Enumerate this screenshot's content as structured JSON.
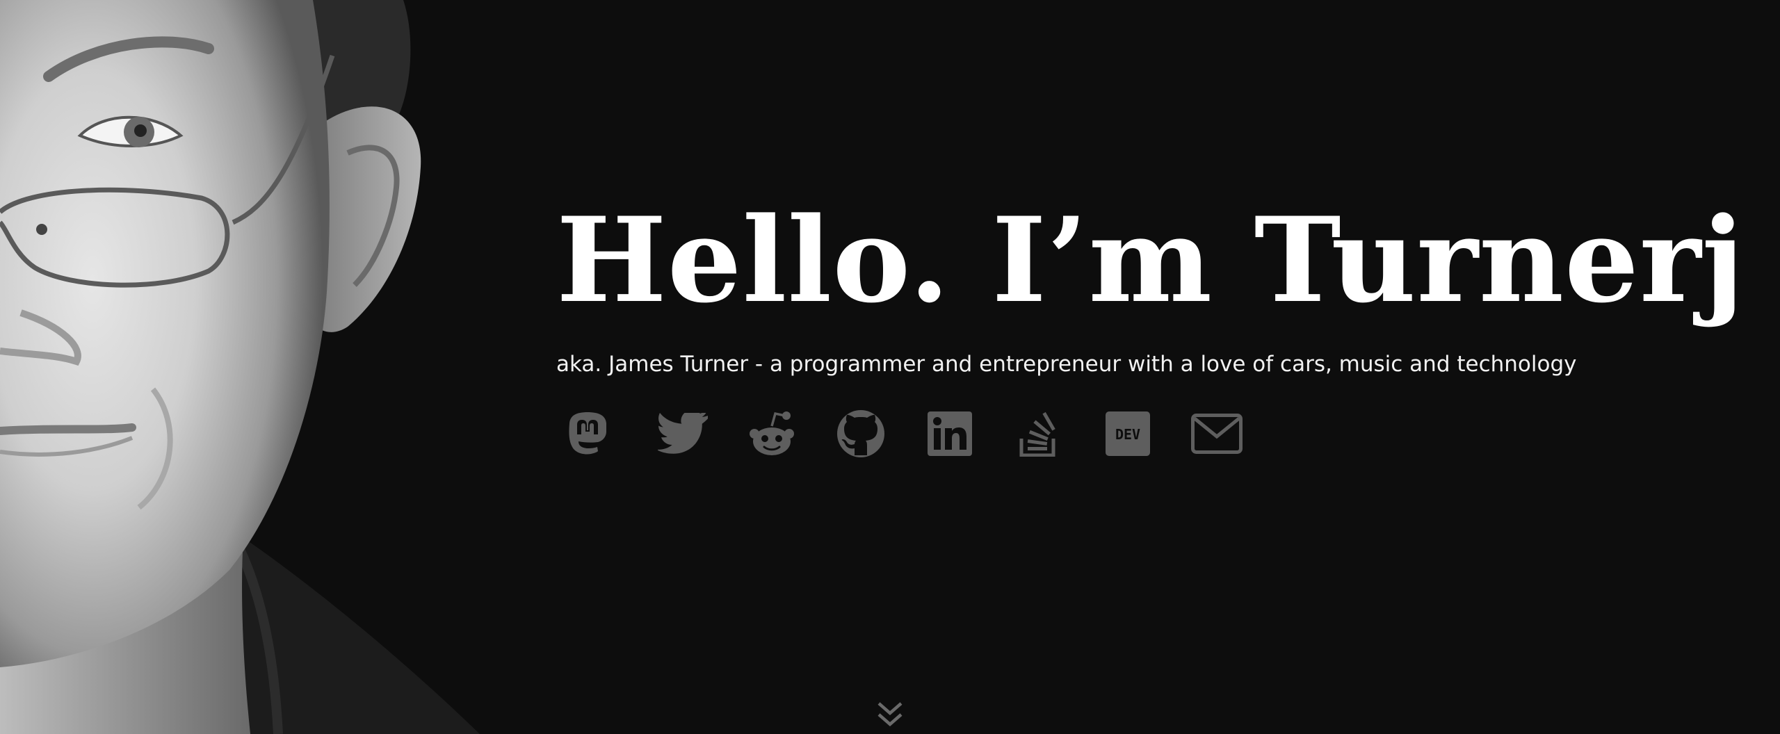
{
  "hero": {
    "headline": "Hello. I’m Turnerj",
    "tagline": "aka. James Turner - a programmer and entrepreneur with a love of cars, music and technology"
  },
  "portrait": {
    "icon": "portrait-illustration"
  },
  "social_links": [
    {
      "name": "Mastodon",
      "icon": "mastodon-icon"
    },
    {
      "name": "Twitter",
      "icon": "twitter-icon"
    },
    {
      "name": "Reddit",
      "icon": "reddit-icon"
    },
    {
      "name": "GitHub",
      "icon": "github-icon"
    },
    {
      "name": "LinkedIn",
      "icon": "linkedin-icon"
    },
    {
      "name": "Stack Overflow",
      "icon": "stackoverflow-icon"
    },
    {
      "name": "DEV",
      "icon": "dev-icon",
      "label": "DEV"
    },
    {
      "name": "Email",
      "icon": "envelope-icon"
    }
  ],
  "scroll_indicator": {
    "icon": "double-chevron-down-icon"
  },
  "colors": {
    "background": "#0d0d0d",
    "headline": "#ffffff",
    "tagline": "#f2f2f2",
    "icon": "#5e5e5e"
  }
}
